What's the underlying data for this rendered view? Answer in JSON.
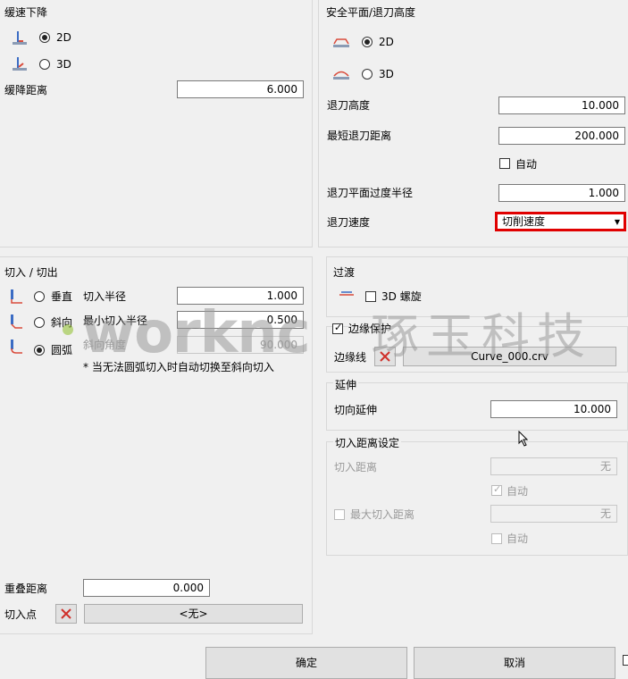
{
  "slow_descent": {
    "title": "缓速下降",
    "opt_2d": "2D",
    "opt_3d": "3D",
    "selected": "2D",
    "distance_label": "缓降距离",
    "distance_value": "6.000"
  },
  "safe_plane": {
    "title": "安全平面/退刀高度",
    "opt_2d": "2D",
    "opt_3d": "3D",
    "selected": "2D",
    "retract_height_label": "退刀高度",
    "retract_height_value": "10.000",
    "min_retract_label": "最短退刀距离",
    "min_retract_value": "200.000",
    "auto_label": "自动",
    "auto_checked": false,
    "plane_radius_label": "退刀平面过度半径",
    "plane_radius_value": "1.000",
    "speed_label": "退刀速度",
    "speed_value": "切削速度"
  },
  "lead_in_out": {
    "title": "切入 / 切出",
    "options": [
      "垂直",
      "斜向",
      "圆弧"
    ],
    "selected": "圆弧",
    "radius_label": "切入半径",
    "radius_value": "1.000",
    "min_radius_label": "最小切入半径",
    "min_radius_value": "0.500",
    "angle_label": "斜向角度",
    "angle_value": "90.000",
    "note": "* 当无法圆弧切入时自动切换至斜向切入",
    "overlap_label": "重叠距离",
    "overlap_value": "0.000",
    "entry_point_label": "切入点",
    "entry_point_value": "<无>"
  },
  "transition": {
    "title": "过渡",
    "spiral_label": "3D 螺旋",
    "spiral_checked": false
  },
  "edge_protect": {
    "title": "边缘保护",
    "checked": true,
    "edge_label": "边缘线",
    "edge_value": "Curve_000.crv"
  },
  "extend": {
    "title": "延伸",
    "tangent_label": "切向延伸",
    "tangent_value": "10.000"
  },
  "lead_distance": {
    "title": "切入距离设定",
    "distance_label": "切入距离",
    "distance_value": "无",
    "auto1_label": "自动",
    "max_label": "最大切入距离",
    "max_value": "无",
    "auto2_label": "自动"
  },
  "watermark": {
    "text": "worknc",
    "brand": "琢玉科技"
  },
  "footer": {
    "ok_label": "确定",
    "cancel_label": "取消"
  },
  "colors": {
    "highlight": "#e00000",
    "accent": "#2a6bd6"
  }
}
